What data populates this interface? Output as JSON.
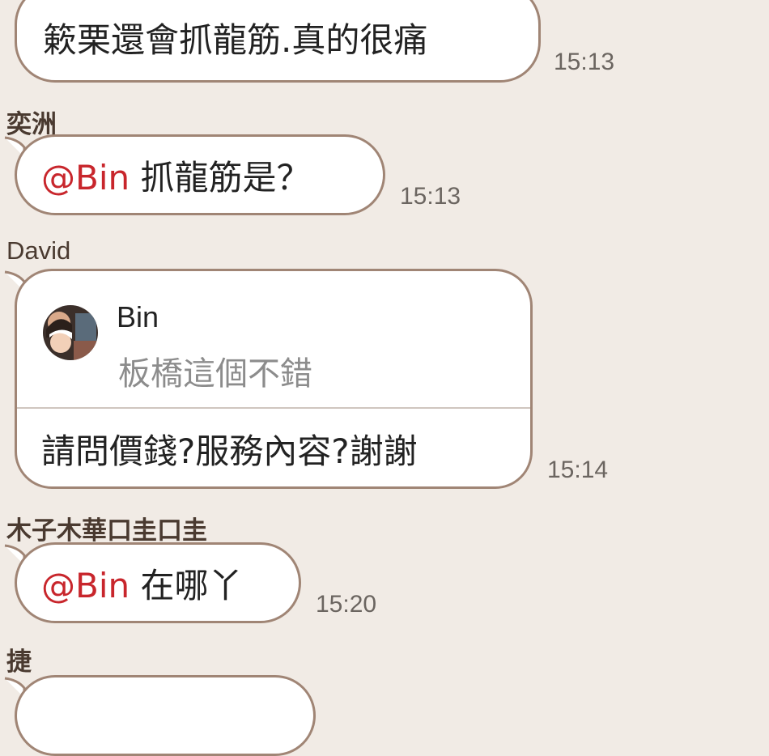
{
  "messages": [
    {
      "text": "簌栗還會抓龍筋.真的很痛",
      "time": "15:13"
    },
    {
      "sender": "奕洲",
      "mention": "@Bin",
      "text": " 抓龍筋是？",
      "time": "15:13"
    },
    {
      "sender": "David",
      "quote": {
        "name": "Bin",
        "text": "板橋這個不錯"
      },
      "text": "請問價錢?服務內容?謝謝",
      "time": "15:14"
    },
    {
      "sender": "木子木華口圭口圭",
      "mention": "@Bin",
      "text": " 在哪丫",
      "time": "15:20"
    },
    {
      "sender": "捷"
    }
  ],
  "colors": {
    "background": "#f1ebe5",
    "bubble_border": "#a08575",
    "mention": "#c8262c"
  }
}
